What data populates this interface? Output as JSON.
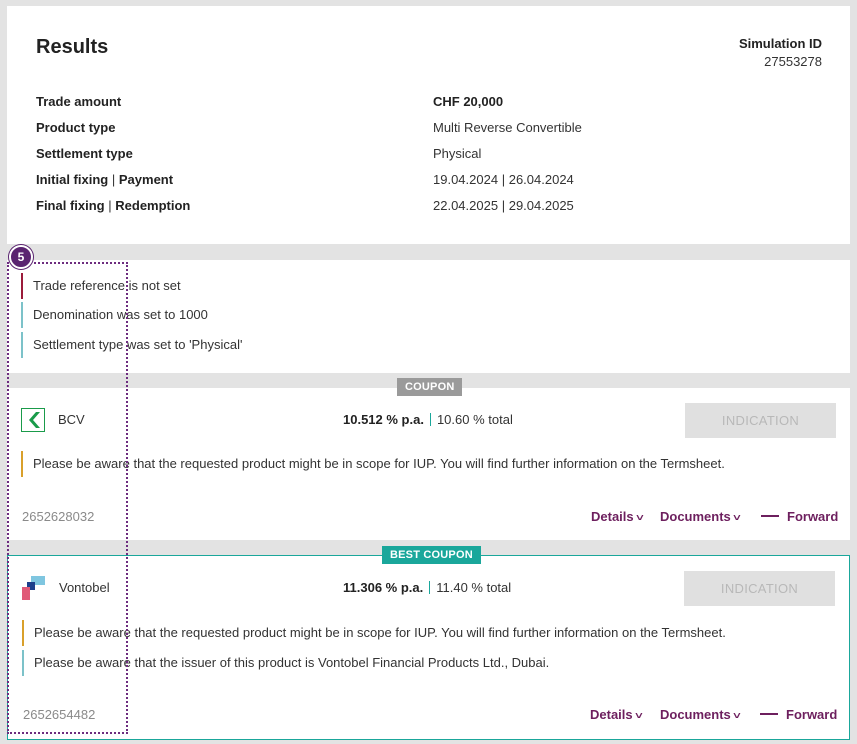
{
  "results": {
    "title": "Results",
    "simulation_id_label": "Simulation ID",
    "simulation_id": "27553278",
    "rows": [
      {
        "label": "Trade amount",
        "value": "CHF 20,000"
      },
      {
        "label": "Product type",
        "value": "Multi Reverse Convertible"
      },
      {
        "label": "Settlement type",
        "value": "Physical"
      },
      {
        "label_a": "Initial fixing",
        "label_b": "Payment",
        "value_a": "19.04.2024",
        "value_b": "26.04.2024"
      },
      {
        "label_a": "Final fixing",
        "label_b": "Redemption",
        "value_a": "22.04.2025",
        "value_b": "29.04.2025"
      }
    ],
    "separator": "|"
  },
  "messages": [
    {
      "text": "Trade reference is not set",
      "color": "#9b1b3a"
    },
    {
      "text": "Denomination was set to 1000",
      "color": "#7cc2c9"
    },
    {
      "text": "Settlement type was set to 'Physical'",
      "color": "#7cc2c9"
    }
  ],
  "offers": [
    {
      "badge": "COUPON",
      "issuer": "BCV",
      "rate": "10.512 % p.a.",
      "total": "10.60 % total",
      "button": "INDICATION",
      "notes": [
        {
          "text": "Please be aware that the requested product might be in scope for IUP. You will find further information on the Termsheet.",
          "color": "#d9a02b"
        }
      ],
      "ref": "2652628032",
      "details": "Details",
      "documents": "Documents",
      "forward": "Forward"
    },
    {
      "badge": "BEST COUPON",
      "issuer": "Vontobel",
      "rate": "11.306 % p.a.",
      "total": "11.40 % total",
      "button": "INDICATION",
      "notes": [
        {
          "text": "Please be aware that the requested product might be in scope for IUP. You will find further information on the Termsheet.",
          "color": "#d9a02b"
        },
        {
          "text": "Please be aware that the issuer of this product is Vontobel Financial Products Ltd., Dubai.",
          "color": "#7cc2c9"
        }
      ],
      "ref": "2652654482",
      "details": "Details",
      "documents": "Documents",
      "forward": "Forward"
    }
  ],
  "overlay": {
    "step": "5",
    "color": "#5a2470"
  },
  "colors": {
    "accent": "#6d1f5e",
    "best": "#1aa79b",
    "coupon_badge": "#9a9a9a"
  }
}
